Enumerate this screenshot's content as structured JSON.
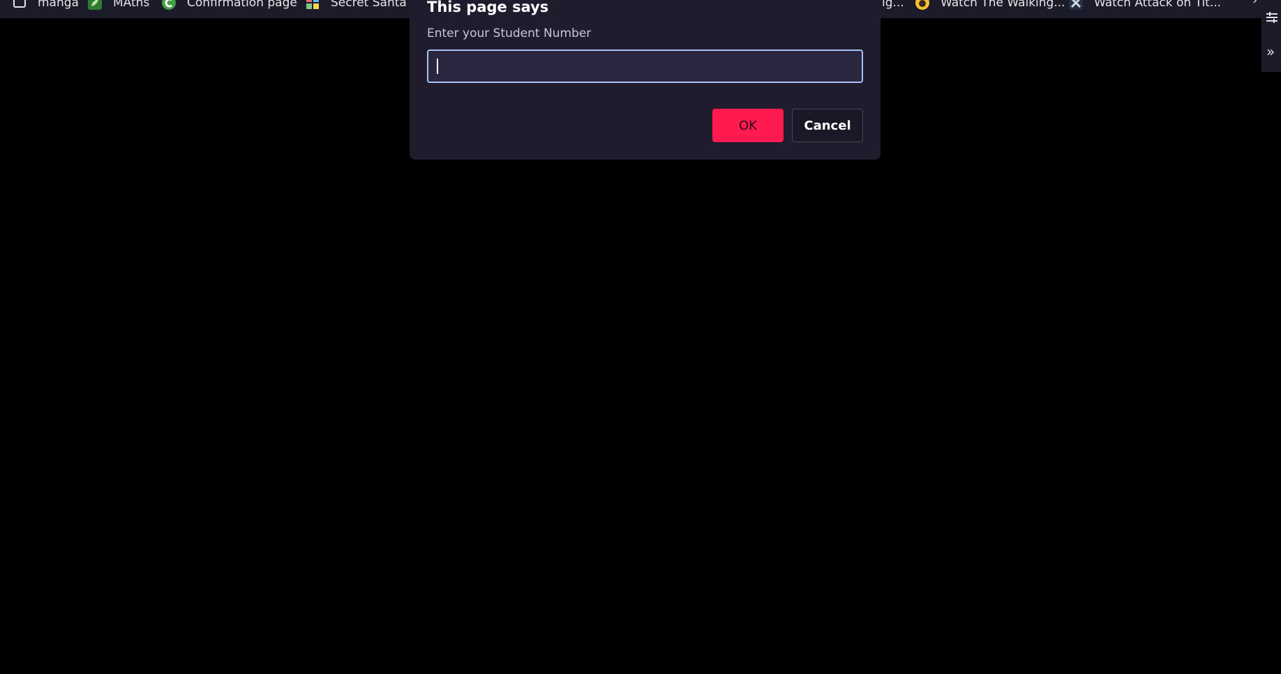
{
  "bookmarks": {
    "items": [
      {
        "label": "manga",
        "icon": "folder-icon"
      },
      {
        "label": "MAths",
        "icon": "leaf-favicon-icon"
      },
      {
        "label": "Confirmation page",
        "icon": "green-c-favicon-icon"
      },
      {
        "label": "Secret Santa O",
        "icon": "grid-favicon-icon"
      },
      {
        "label": "ig...",
        "icon": "page-favicon-icon"
      },
      {
        "label": "Watch The Walking...",
        "icon": "yellow-face-favicon-icon"
      },
      {
        "label": "Watch Attack on Tit...",
        "icon": "star-favicon-icon"
      }
    ],
    "overflow": "›"
  },
  "side_panel": {
    "expand_label": "»",
    "icon": "tune-icon"
  },
  "dialog": {
    "title": "This page says",
    "message": "Enter your Student Number",
    "input_value": "",
    "ok_label": "OK",
    "cancel_label": "Cancel"
  },
  "colors": {
    "background": "#000000",
    "dialog_bg": "#201c2e",
    "ok_accent": "#ff1a4f",
    "input_focus_border": "#a9c3f7"
  }
}
